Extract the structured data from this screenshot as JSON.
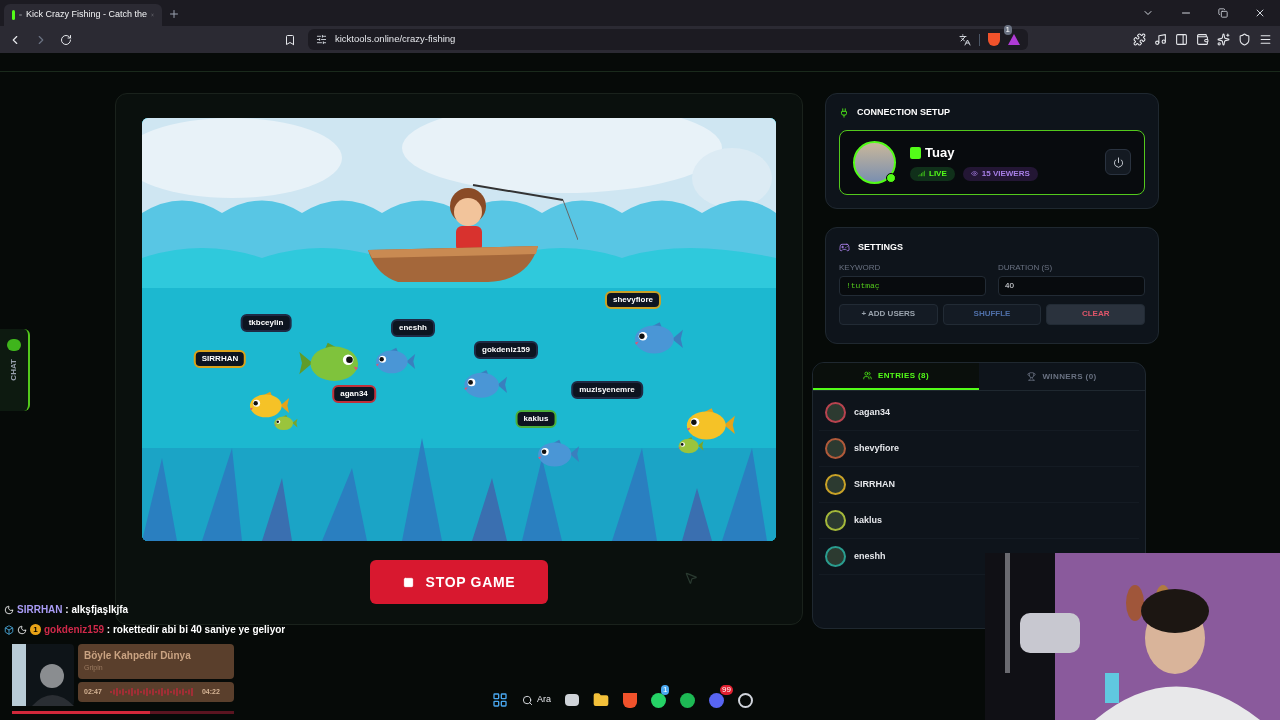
{
  "browser": {
    "tab_title": "Kick Crazy Fishing - Catch the",
    "url": "kicktools.online/crazy-fishing",
    "shield_badge": "1"
  },
  "chat_tab": {
    "label": "CHAT"
  },
  "game": {
    "players": [
      {
        "name": "tkbceylin",
        "color": "#1f2a44"
      },
      {
        "name": "SIRRHAN",
        "color": "#d9a21b"
      },
      {
        "name": "eneshh",
        "color": "#1f2a44"
      },
      {
        "name": "agan34",
        "color": "#c0303a"
      },
      {
        "name": "gokdeniz159",
        "color": "#1f2a44"
      },
      {
        "name": "shevyfiore",
        "color": "#c9a227"
      },
      {
        "name": "muzisyenemre",
        "color": "#1f2a44"
      },
      {
        "name": "kaklus",
        "color": "#4caf3a"
      }
    ],
    "stop_button": "STOP GAME"
  },
  "connection": {
    "title": "CONNECTION SETUP",
    "channel": "Tuay",
    "live": "LIVE",
    "viewers": "15 VIEWERS"
  },
  "settings": {
    "title": "SETTINGS",
    "keyword_label": "KEYWORD",
    "keyword": "!tutmaç",
    "duration_label": "DURATION (S)",
    "duration": "40",
    "buttons": [
      {
        "label": "+ ADD USERS",
        "kind": "add"
      },
      {
        "label": "SHUFFLE",
        "kind": "shuffle"
      },
      {
        "label": "CLEAR",
        "kind": "clear"
      }
    ]
  },
  "tabs": [
    {
      "label": "ENTRIES (8)",
      "selected": true,
      "kind": "entries"
    },
    {
      "label": "WINNERS (0)",
      "selected": false,
      "kind": "winners"
    }
  ],
  "entries": [
    {
      "name": "cagan34",
      "color": "#b8434f"
    },
    {
      "name": "shevyfiore",
      "color": "#b05a3a"
    },
    {
      "name": "SIRRHAN",
      "color": "#c9a227"
    },
    {
      "name": "kaklus",
      "color": "#a4b83a"
    },
    {
      "name": "eneshh",
      "color": "#2a9d8f"
    }
  ],
  "stream_chat": [
    {
      "user": "SIRRHAN",
      "color": "#a99cf5",
      "text": " : alkşfjaşlkjfa"
    },
    {
      "user": "gokdeniz159",
      "color": "#d0294a",
      "text": " : rokettedir abi bi 40 saniye ye geliyor"
    }
  ],
  "coin_badge": "1",
  "now_playing": {
    "title": "Böyle Kahpedir Dünya",
    "artist": "Gripin",
    "elapsed": "02:47",
    "total": "04:22",
    "level": 0.62
  },
  "taskbar": {
    "search": "Ara",
    "whatsapp_badge": "1",
    "discord_badge": "99"
  }
}
